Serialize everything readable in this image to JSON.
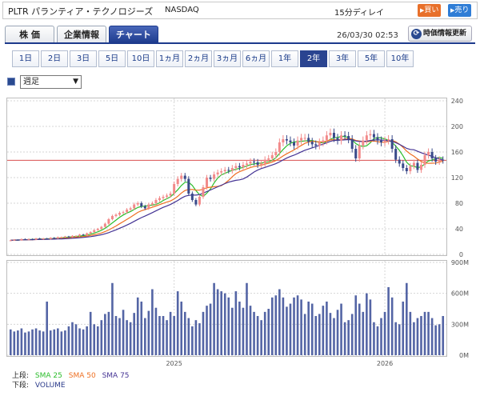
{
  "header": {
    "title": "PLTR パランティア・テクノロジーズ",
    "exchange": "NASDAQ",
    "delay": "15分ディレイ",
    "buy_label": "買い",
    "sell_label": "売り"
  },
  "tabs": [
    {
      "label": "株 価",
      "active": false
    },
    {
      "label": "企業情報",
      "active": false
    },
    {
      "label": "チャート",
      "active": true
    }
  ],
  "timestamp": "26/03/30 02:53",
  "refresh_label": "時価情報更新",
  "periods": [
    {
      "label": "1日"
    },
    {
      "label": "2日"
    },
    {
      "label": "3日"
    },
    {
      "label": "5日"
    },
    {
      "label": "10日"
    },
    {
      "label": "1ヵ月"
    },
    {
      "label": "2ヵ月"
    },
    {
      "label": "3ヵ月"
    },
    {
      "label": "6ヵ月"
    },
    {
      "label": "1年"
    },
    {
      "label": "2年",
      "active": true
    },
    {
      "label": "3年"
    },
    {
      "label": "5年"
    },
    {
      "label": "10年"
    }
  ],
  "interval_select": {
    "value": "週足"
  },
  "legend": {
    "upper_prefix": "上段:",
    "lower_prefix": "下段:",
    "sma25": "SMA 25",
    "sma50": "SMA 50",
    "sma75": "SMA 75",
    "volume": "VOLUME"
  },
  "chart_data": {
    "type": "candlestick",
    "price_axis": {
      "ticks": [
        "240",
        "200",
        "160",
        "120",
        "80",
        "40",
        "0"
      ],
      "ylim": [
        0,
        240
      ]
    },
    "volume_axis": {
      "ticks": [
        "900M",
        "600M",
        "300M",
        "0M"
      ],
      "ylim": [
        0,
        900
      ]
    },
    "x_ticks": [
      {
        "label": "2025",
        "week": 45
      },
      {
        "label": "2026",
        "week": 103
      }
    ],
    "current_price": 147,
    "colors": {
      "up": "#f28a8a",
      "down": "#3a4a8a",
      "sma25": "#2bbd2b",
      "sma50": "#ee6f22",
      "sma75": "#443394",
      "volume": "#5465a5",
      "price_line": "#d95050",
      "grid": "#d5d5d5"
    },
    "weeks": 120,
    "close": [
      22,
      23,
      22,
      24,
      23,
      24,
      23,
      25,
      24,
      25,
      24,
      26,
      25,
      27,
      27,
      28,
      27,
      29,
      29,
      31,
      30,
      33,
      35,
      38,
      40,
      43,
      48,
      55,
      60,
      62,
      65,
      66,
      70,
      72,
      78,
      80,
      75,
      72,
      78,
      80,
      85,
      88,
      90,
      92,
      95,
      110,
      118,
      123,
      118,
      95,
      85,
      78,
      90,
      105,
      120,
      118,
      125,
      128,
      130,
      132,
      131,
      135,
      138,
      136,
      140,
      142,
      145,
      144,
      140,
      142,
      148,
      150,
      155,
      160,
      175,
      180,
      178,
      175,
      170,
      178,
      182,
      182,
      176,
      172,
      170,
      175,
      178,
      186,
      190,
      182,
      178,
      186,
      185,
      180,
      165,
      150,
      170,
      178,
      186,
      188,
      183,
      178,
      175,
      178,
      180,
      165,
      148,
      142,
      135,
      130,
      138,
      143,
      132,
      140,
      155,
      160,
      150,
      145,
      148,
      147
    ],
    "volume": [
      250,
      230,
      240,
      260,
      220,
      230,
      250,
      260,
      240,
      230,
      520,
      240,
      250,
      260,
      230,
      240,
      280,
      320,
      300,
      260,
      250,
      280,
      420,
      300,
      280,
      340,
      400,
      420,
      700,
      380,
      360,
      440,
      340,
      320,
      410,
      560,
      520,
      360,
      430,
      640,
      460,
      380,
      380,
      340,
      420,
      380,
      620,
      520,
      420,
      360,
      280,
      340,
      310,
      420,
      480,
      500,
      700,
      640,
      620,
      600,
      560,
      460,
      620,
      520,
      460,
      700,
      480,
      420,
      380,
      340,
      420,
      450,
      560,
      580,
      640,
      560,
      470,
      500,
      560,
      580,
      540,
      400,
      520,
      500,
      380,
      400,
      480,
      520,
      410,
      360,
      440,
      500,
      320,
      340,
      400,
      580,
      500,
      420,
      600,
      540,
      320,
      280,
      360,
      420,
      660,
      560,
      320,
      300,
      520,
      700,
      420,
      320,
      360,
      380,
      420,
      420,
      360,
      290,
      300,
      380
    ]
  }
}
